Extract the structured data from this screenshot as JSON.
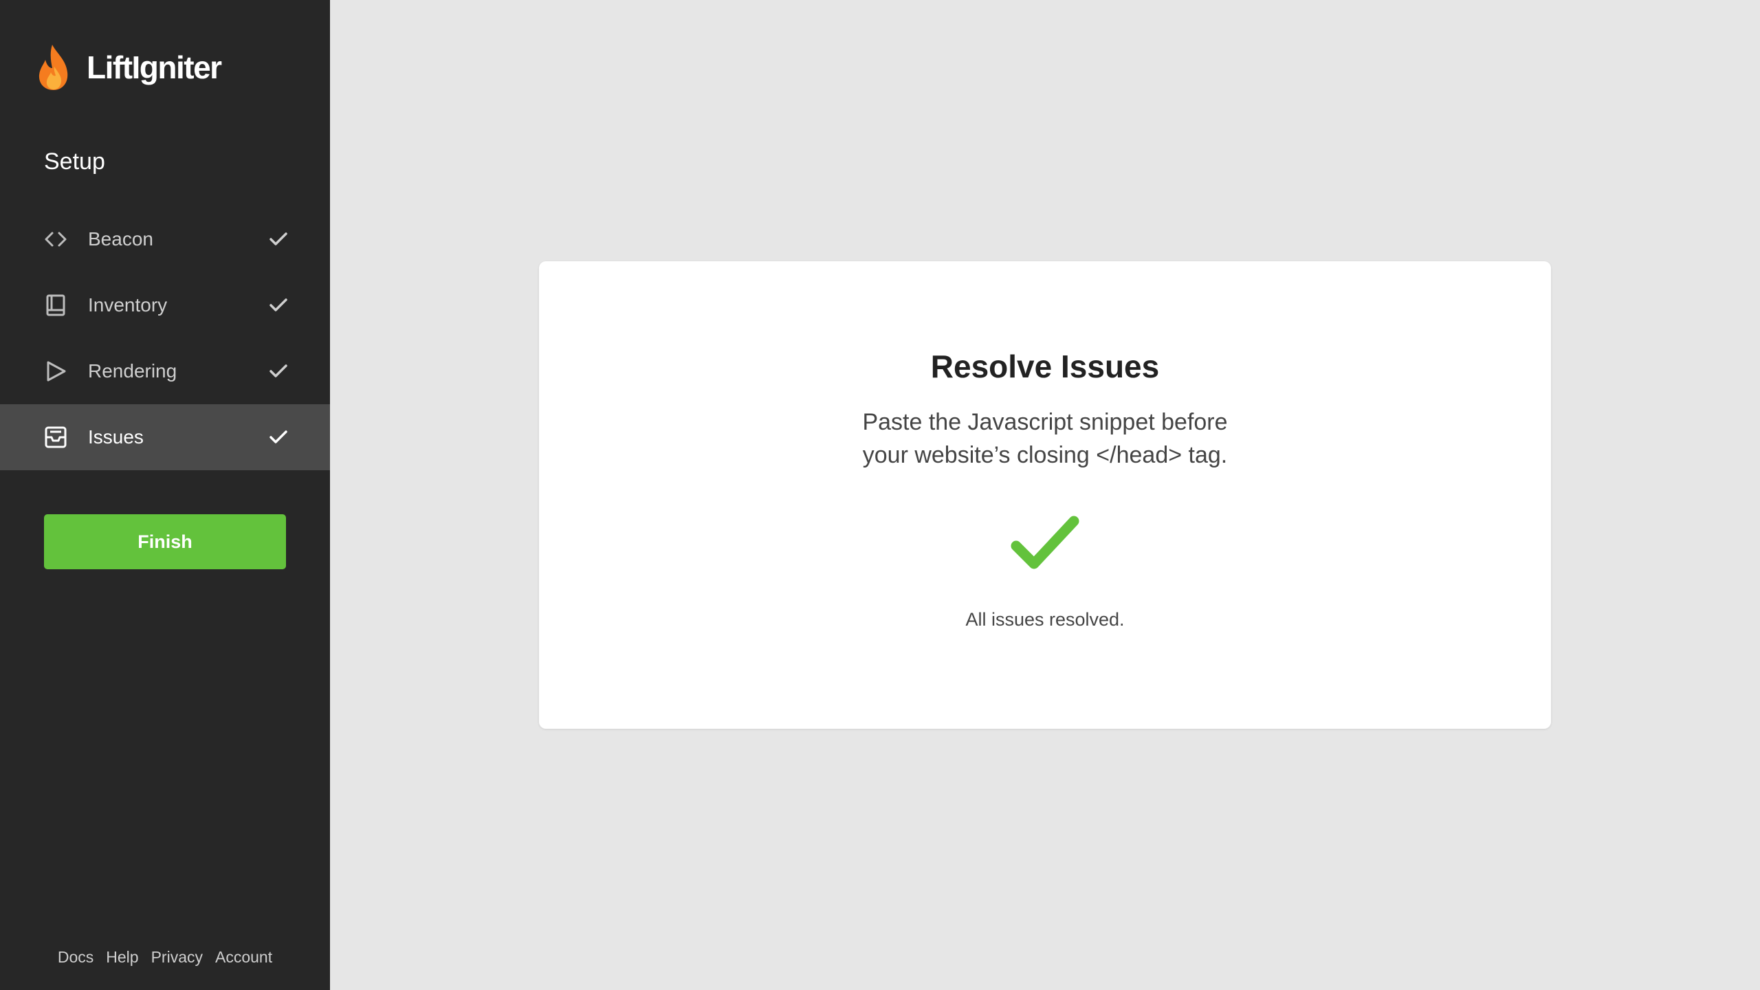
{
  "brand": {
    "name": "LiftIgniter",
    "flame_color": "#f57c1f"
  },
  "sidebar": {
    "section_title": "Setup",
    "items": [
      {
        "label": "Beacon",
        "icon": "code-icon",
        "completed": true,
        "active": false
      },
      {
        "label": "Inventory",
        "icon": "book-icon",
        "completed": true,
        "active": false
      },
      {
        "label": "Rendering",
        "icon": "play-icon",
        "completed": true,
        "active": false
      },
      {
        "label": "Issues",
        "icon": "inbox-icon",
        "completed": true,
        "active": true
      }
    ],
    "finish_label": "Finish",
    "footer_links": [
      "Docs",
      "Help",
      "Privacy",
      "Account"
    ]
  },
  "main": {
    "title": "Resolve Issues",
    "description_line1": "Paste the Javascript snippet before",
    "description_line2": "your website’s closing </head> tag.",
    "status_icon": "checkmark-icon",
    "status_text": "All issues resolved."
  },
  "colors": {
    "sidebar_bg": "#272727",
    "active_item_bg": "#4a4a4a",
    "accent_green": "#63c23c",
    "page_bg": "#e6e6e6"
  }
}
